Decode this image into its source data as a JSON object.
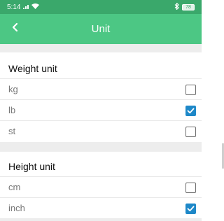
{
  "status_bar": {
    "time": "5:14",
    "battery": "78",
    "icons": [
      "signal-icon",
      "wifi-icon",
      "bluetooth-icon",
      "battery-icon"
    ]
  },
  "header": {
    "title": "Unit",
    "back_icon": "chevron-left-icon"
  },
  "colors": {
    "header_bg": "#4cc784",
    "status_bg": "#3aa86b",
    "checkbox_checked": "#1e88c8",
    "section_gap": "#ededed"
  },
  "sections": [
    {
      "title": "Weight unit",
      "options": [
        {
          "label": "kg",
          "checked": false
        },
        {
          "label": "lb",
          "checked": true
        },
        {
          "label": "st",
          "checked": false
        }
      ]
    },
    {
      "title": "Height unit",
      "options": [
        {
          "label": "cm",
          "checked": false
        },
        {
          "label": "inch",
          "checked": true
        }
      ]
    }
  ]
}
